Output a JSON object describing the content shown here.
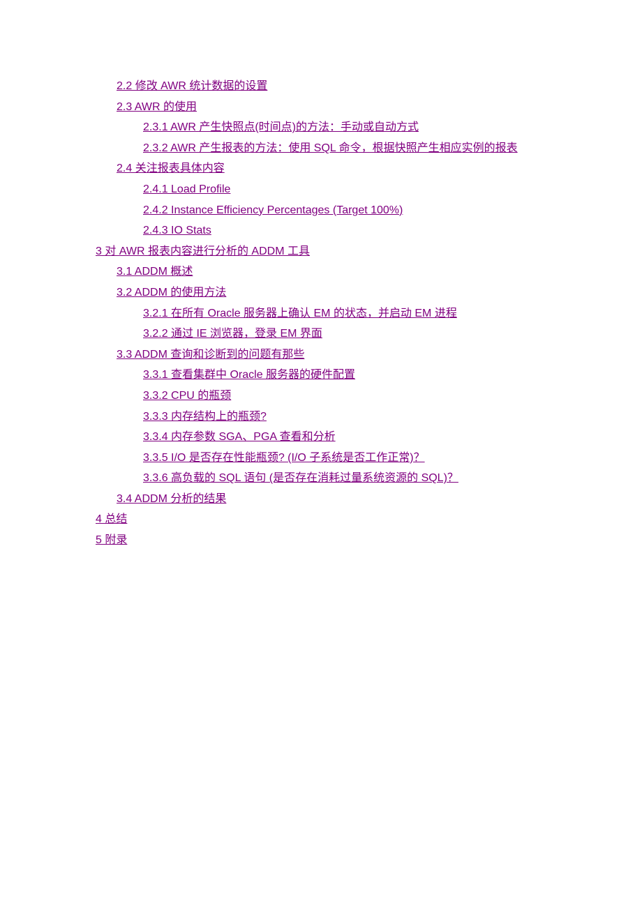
{
  "toc": {
    "items": [
      {
        "level": 2,
        "label": "2.2 修改 AWR 统计数据的设置"
      },
      {
        "level": 2,
        "label": "2.3 AWR 的使用"
      },
      {
        "level": 3,
        "label": "2.3.1 AWR 产生快照点(时间点)的方法：手动或自动方式"
      },
      {
        "level": 3,
        "label": "2.3.2 AWR 产生报表的方法：使用 SQL 命令，根据快照产生相应实例的报表"
      },
      {
        "level": 2,
        "label": "2.4 关注报表具体内容"
      },
      {
        "level": 3,
        "label": "2.4.1 Load Profile"
      },
      {
        "level": 3,
        "label": "2.4.2 Instance Efficiency Percentages (Target 100%)"
      },
      {
        "level": 3,
        "label": "2.4.3 IO Stats"
      },
      {
        "level": 1,
        "label": "3 对 AWR 报表内容进行分析的 ADDM 工具"
      },
      {
        "level": 2,
        "label": "3.1 ADDM 概述"
      },
      {
        "level": 2,
        "label": "3.2 ADDM 的使用方法"
      },
      {
        "level": 3,
        "label": "3.2.1 在所有 Oracle 服务器上确认 EM 的状态，并启动 EM 进程"
      },
      {
        "level": 3,
        "label": "3.2.2 通过 IE 浏览器，登录 EM 界面"
      },
      {
        "level": 2,
        "label": "3.3 ADDM 查询和诊断到的问题有那些"
      },
      {
        "level": 3,
        "label": "3.3.1 查看集群中 Oracle 服务器的硬件配置"
      },
      {
        "level": 3,
        "label": "3.3.2 CPU 的瓶颈"
      },
      {
        "level": 3,
        "label": "3.3.3 内存结构上的瓶颈? "
      },
      {
        "level": 3,
        "label": "3.3.4 内存参数 SGA、PGA 查看和分析"
      },
      {
        "level": 3,
        "label": "3.3.5 I/O 是否存在性能瓶颈? (I/O 子系统是否工作正常)？"
      },
      {
        "level": 3,
        "label": "3.3.6 高负载的 SQL 语句 (是否存在消耗过量系统资源的 SQL)？"
      },
      {
        "level": 2,
        "label": "3.4 ADDM 分析的结果"
      },
      {
        "level": 1,
        "label": "4 总结"
      },
      {
        "level": 1,
        "label": "5 附录"
      }
    ]
  }
}
